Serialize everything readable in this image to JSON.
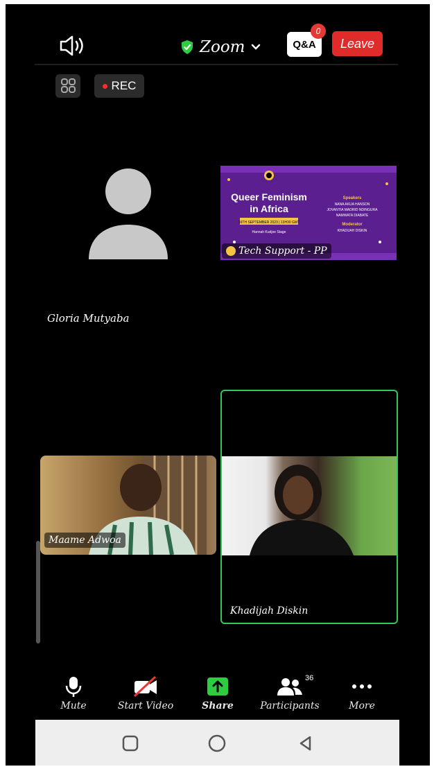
{
  "top_bar": {
    "app_name": "Zoom",
    "qa_label": "Q&A",
    "qa_badge": "0",
    "leave_label": "Leave"
  },
  "controls": {
    "rec_label": "REC"
  },
  "participants": {
    "gloria": {
      "name": "Gloria Mutyaba"
    },
    "tech_support": {
      "name": "Tech Support - PP",
      "poster": {
        "title_line1": "Queer Feminism",
        "title_line2": "in Africa",
        "date_text": "16TH SEPTEMBER 2023 | 13H30 GMT",
        "host_text": "Hannah Kudjoe Stage",
        "speakers_heading": "Speakers",
        "speakers": [
          "NANA AKUA HANSON",
          "JOVANTIA MADRID NDINGURA",
          "NAMWATA DIABATE"
        ],
        "moderator_heading": "Moderator",
        "moderator": "KHADIJAH DISKIN"
      }
    },
    "maame": {
      "name": "Maame Adwoa"
    },
    "khadijah": {
      "name": "Khadijah Diskin"
    }
  },
  "toolbar": {
    "mute_label": "Mute",
    "video_label": "Start Video",
    "share_label": "Share",
    "participants_label": "Participants",
    "participants_count": "36",
    "more_label": "More"
  },
  "colors": {
    "leave_red": "#e02b2b",
    "active_speaker_border": "#34c759",
    "share_green": "#2ecc40",
    "poster_purple": "#5b1f8f"
  },
  "icons": [
    "speaker-icon",
    "shield-check-icon",
    "chevron-down-icon",
    "grid-icon",
    "mic-icon",
    "video-off-icon",
    "share-arrow-icon",
    "participants-icon",
    "more-dots-icon",
    "nav-square-icon",
    "nav-circle-icon",
    "nav-back-icon"
  ]
}
